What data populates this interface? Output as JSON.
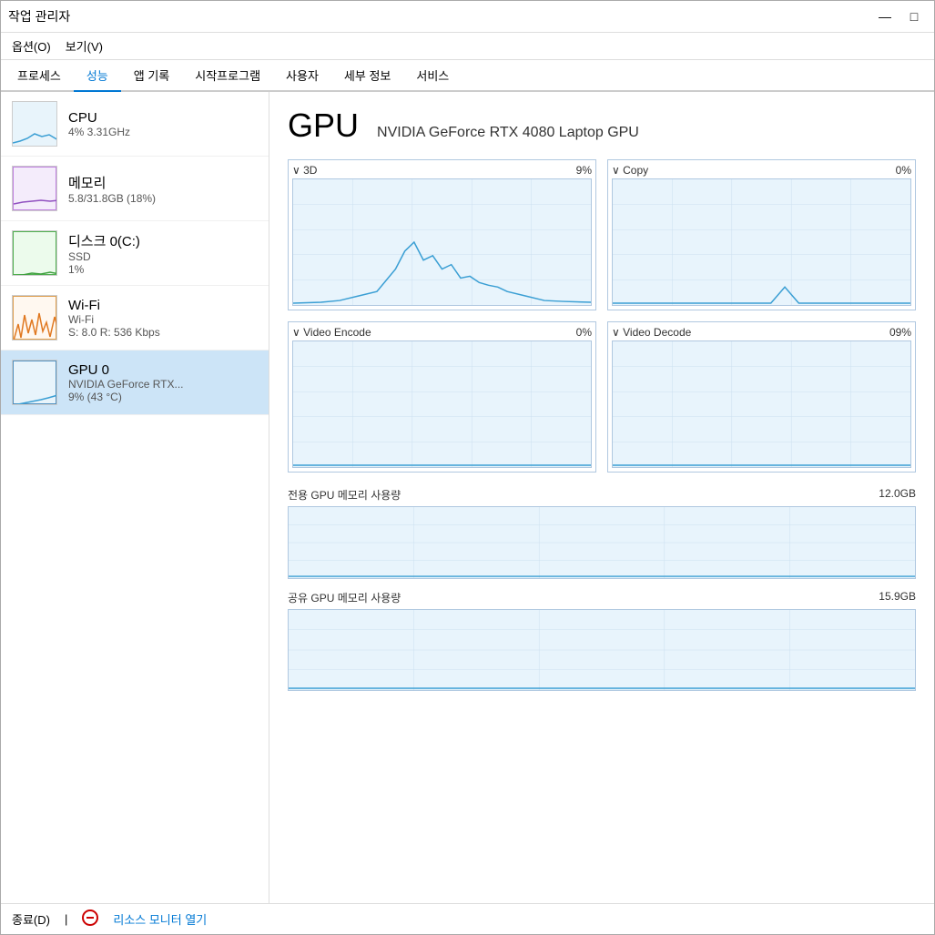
{
  "window": {
    "title": "작업 관리자",
    "min_btn": "—",
    "max_btn": "□",
    "close_btn": "✕"
  },
  "menu": {
    "options": "옵션(O)",
    "view": "보기(V)"
  },
  "tabs": [
    {
      "label": "프로세스",
      "active": false
    },
    {
      "label": "성능",
      "active": true
    },
    {
      "label": "앱 기록",
      "active": false
    },
    {
      "label": "시작프로그램",
      "active": false
    },
    {
      "label": "사용자",
      "active": false
    },
    {
      "label": "세부 정보",
      "active": false
    },
    {
      "label": "서비스",
      "active": false
    }
  ],
  "sidebar": {
    "items": [
      {
        "id": "cpu",
        "title": "CPU",
        "sub1": "4%  3.31GHz",
        "sub2": "",
        "active": false,
        "thumb_type": "cpu"
      },
      {
        "id": "memory",
        "title": "메모리",
        "sub1": "5.8/31.8GB (18%)",
        "sub2": "",
        "active": false,
        "thumb_type": "mem"
      },
      {
        "id": "disk",
        "title": "디스크 0(C:)",
        "sub1": "SSD",
        "sub2": "1%",
        "active": false,
        "thumb_type": "disk"
      },
      {
        "id": "wifi",
        "title": "Wi-Fi",
        "sub1": "Wi-Fi",
        "sub2": "S: 8.0  R: 536 Kbps",
        "active": false,
        "thumb_type": "wifi"
      },
      {
        "id": "gpu0",
        "title": "GPU 0",
        "sub1": "NVIDIA GeForce RTX...",
        "sub2": "9% (43 °C)",
        "active": true,
        "thumb_type": "gpu"
      }
    ]
  },
  "gpu_panel": {
    "title": "GPU",
    "gpu_name": "NVIDIA GeForce RTX 4080 Laptop GPU",
    "charts": [
      {
        "label": "3D",
        "pct": "9%",
        "id": "3d"
      },
      {
        "label": "Copy",
        "pct": "0%",
        "id": "copy"
      },
      {
        "label": "Video Encode",
        "pct": "0%",
        "id": "vencode"
      },
      {
        "label": "Video Decode",
        "pct": "09%",
        "id": "vdecode"
      }
    ],
    "dedicated_mem_label": "전용 GPU 메모리 사용량",
    "dedicated_mem_value": "12.0GB",
    "shared_mem_label": "공유 GPU 메모리 사용량",
    "shared_mem_value": "15.9GB"
  },
  "bottom": {
    "close_btn": "종료(D)",
    "resource_monitor_link": "리소스 모니터 열기"
  },
  "colors": {
    "accent": "#0078d4",
    "chart_line": "#3b9fd4",
    "chart_bg": "#e8f4fc",
    "chart_border": "#b0c8e0",
    "sidebar_active_bg": "#cce4f7"
  }
}
